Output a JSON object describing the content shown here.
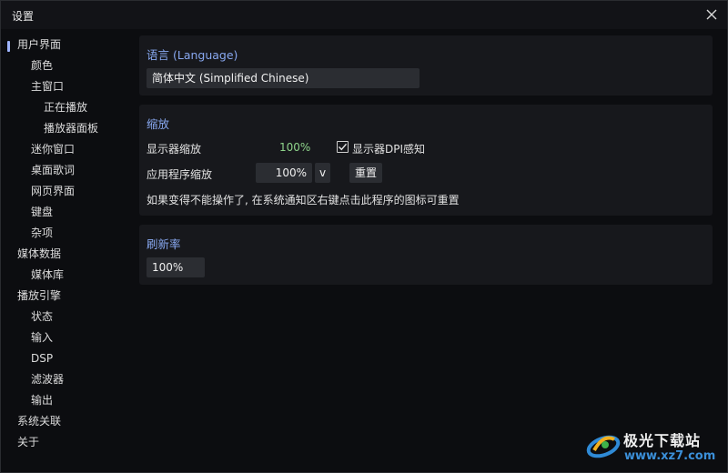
{
  "window": {
    "title": "设置"
  },
  "sidebar": {
    "items": [
      {
        "label": "用户界面",
        "level": 0,
        "selected": true
      },
      {
        "label": "颜色",
        "level": 1
      },
      {
        "label": "主窗口",
        "level": 1
      },
      {
        "label": "正在播放",
        "level": 2
      },
      {
        "label": "播放器面板",
        "level": 2
      },
      {
        "label": "迷你窗口",
        "level": 1
      },
      {
        "label": "桌面歌词",
        "level": 1
      },
      {
        "label": "网页界面",
        "level": 1
      },
      {
        "label": "键盘",
        "level": 1
      },
      {
        "label": "杂项",
        "level": 1
      },
      {
        "label": "媒体数据",
        "level": 0
      },
      {
        "label": "媒体库",
        "level": 1
      },
      {
        "label": "播放引擎",
        "level": 0
      },
      {
        "label": "状态",
        "level": 1
      },
      {
        "label": "输入",
        "level": 1
      },
      {
        "label": "DSP",
        "level": 1
      },
      {
        "label": "滤波器",
        "level": 1
      },
      {
        "label": "输出",
        "level": 1
      },
      {
        "label": "系统关联",
        "level": 0
      },
      {
        "label": "关于",
        "level": 0
      }
    ]
  },
  "language": {
    "title": "语言 (Language)",
    "selected": "简体中文 (Simplified Chinese)"
  },
  "scale": {
    "title": "缩放",
    "display_label": "显示器缩放",
    "display_value": "100%",
    "dpi_aware_label": "显示器DPI感知",
    "dpi_aware_checked": true,
    "app_label": "应用程序缩放",
    "app_value": "100%",
    "app_dropdown": "v",
    "reset_label": "重置",
    "hint": "如果变得不能操作了, 在系统通知区右键点击此程序的图标可重置"
  },
  "refresh": {
    "title": "刷新率",
    "value": "100%"
  },
  "watermark": {
    "name": "极光下载站",
    "url": "www.xz7.com"
  },
  "colors": {
    "accent": "#88a8f0",
    "positive": "#8fd48b",
    "panel": "#17181c",
    "background": "#0c0d10"
  }
}
